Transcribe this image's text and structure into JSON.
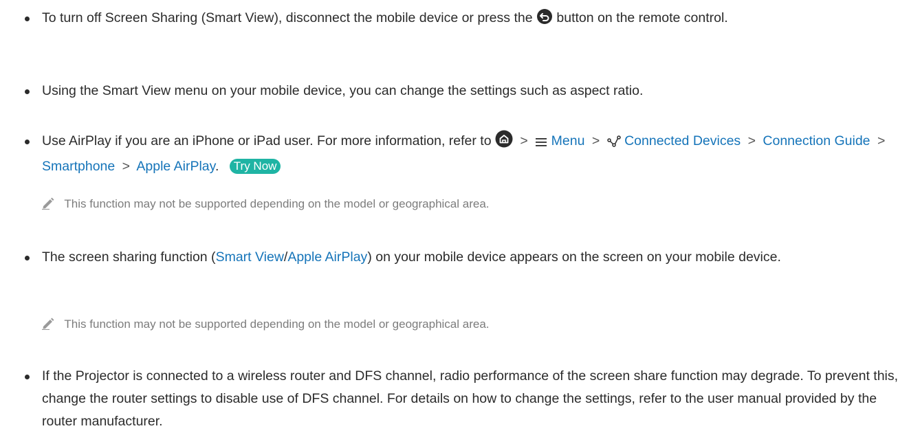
{
  "items": [
    {
      "part1": "To turn off Screen Sharing (Smart View), disconnect the mobile device or press the",
      "part2": "button on the remote control.",
      "return_icon": "return-icon"
    },
    {
      "text": "Using the Smart View menu on your mobile device, you can change the settings such as aspect ratio."
    },
    {
      "lead": "Use AirPlay if you are an iPhone or iPad user. For more information, refer to",
      "home_icon": "home-icon",
      "path_menu": "Menu",
      "path_connected_devices": "Connected Devices",
      "path_connection_guide": "Connection Guide",
      "path_smartphone": "Smartphone",
      "path_apple_airplay": "Apple AirPlay",
      "period": ".",
      "try_now": "Try Now"
    },
    {
      "lead": "The screen sharing function (",
      "link_smart_view": "Smart View",
      "slash": "/",
      "link_apple_airplay": "Apple AirPlay",
      "tail": ") on your mobile device appears on the screen on your mobile device."
    },
    {
      "text": "If the Projector is connected to a wireless router and DFS channel, radio performance of the screen share function may degrade. To prevent this, change the router settings to disable use of DFS channel. For details on how to change the settings, refer to the user manual provided by the router manufacturer."
    }
  ],
  "notes": [
    {
      "text": "This function may not be supported depending on the model or geographical area."
    },
    {
      "text": "This function may not be supported depending on the model or geographical area."
    }
  ],
  "separator": ">",
  "colors": {
    "link": "#1574b9",
    "try_now_bg": "#1fb4a4",
    "note_text": "#7c7c7c",
    "body_text": "#2b2b2b"
  }
}
